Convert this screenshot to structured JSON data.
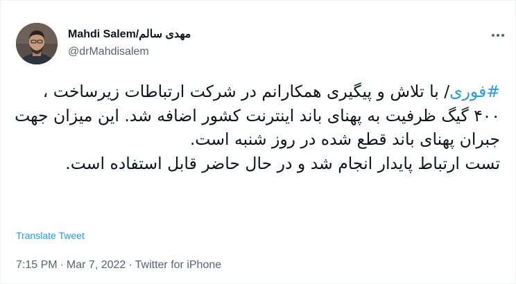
{
  "author": {
    "display_name": "Mahdi Salem/مهدی سالم",
    "handle": "@drMahdisalem",
    "avatar_description": "avatar"
  },
  "more_icon": "more-horizontal-icon",
  "tweet": {
    "hashtag": "#فوری",
    "line1_rest": "/ با تلاش و پیگیری همکارانم در شرکت ارتباطات زیرساخت ، ۴۰۰ گیگ ظرفیت به پهنای باند اینترنت کشور اضافه شد. این میزان جهت جبران پهنای باند قطع شده در روز شنبه است.",
    "paragraph2": "تست ارتباط پایدار انجام شد و در حال حاضر قابل استفاده است."
  },
  "translate_label": "Translate Tweet",
  "meta": {
    "time": "7:15 PM",
    "separator": "·",
    "date": "Mar 7, 2022",
    "source": "Twitter for iPhone"
  },
  "colors": {
    "accent": "#1d9bf0",
    "secondary_text": "#536471",
    "primary_text": "#0f1419"
  }
}
